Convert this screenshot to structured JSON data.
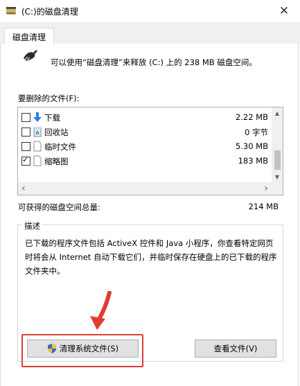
{
  "window": {
    "title": "(C:)的磁盘清理",
    "close_glyph": "✕"
  },
  "tabs": [
    {
      "label": "磁盘清理"
    }
  ],
  "intro_text": "可以使用“磁盘清理”来释放 (C:) 上的 238 MB 磁盘空间。",
  "files_label": "要删除的文件(F):",
  "files": [
    {
      "name": "下载",
      "size": "2.22 MB",
      "checked": false,
      "icon": "download-arrow-icon"
    },
    {
      "name": "回收站",
      "size": "0 字节",
      "checked": false,
      "icon": "recycle-bin-icon"
    },
    {
      "name": "临时文件",
      "size": "5.30 MB",
      "checked": false,
      "icon": "blank-file-icon"
    },
    {
      "name": "缩略图",
      "size": "183 MB",
      "checked": true,
      "icon": "blank-file-icon"
    }
  ],
  "total": {
    "label": "可获得的磁盘空间总量:",
    "value": "214 MB"
  },
  "description": {
    "legend": "描述",
    "text": "已下载的程序文件包括 ActiveX 控件和 Java 小程序，你查看特定网页时将会从 Internet 自动下载它们，并临时保存在硬盘上的已下载的程序文件夹中。"
  },
  "buttons": {
    "cleanup_system": "清理系统文件(S)",
    "view_files": "查看文件(V)"
  },
  "colors": {
    "highlight": "#e03c31",
    "download_arrow": "#2b7de9"
  }
}
